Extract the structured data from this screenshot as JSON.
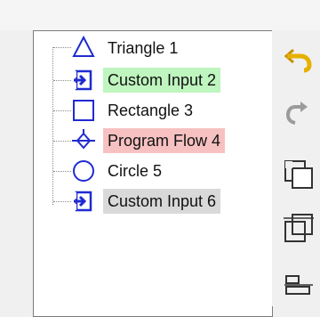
{
  "tree": {
    "items": [
      {
        "label": "Triangle 1",
        "icon": "triangle-icon",
        "highlight": null
      },
      {
        "label": "Custom Input 2",
        "icon": "custom-input-icon",
        "highlight": "#bff5bf"
      },
      {
        "label": "Rectangle 3",
        "icon": "rectangle-icon",
        "highlight": null
      },
      {
        "label": "Program Flow 4",
        "icon": "program-flow-icon",
        "highlight": "#f7c1c1"
      },
      {
        "label": "Circle 5",
        "icon": "circle-icon",
        "highlight": null
      },
      {
        "label": "Custom Input 6",
        "icon": "custom-input-icon",
        "highlight": "#d9d9d9"
      }
    ],
    "icon_color": "#1f2bd1"
  },
  "toolbar": {
    "tools": [
      "undo-icon",
      "redo-icon",
      "bring-forward-icon",
      "send-backward-icon",
      "align-icon"
    ],
    "accent": "#e6b000"
  }
}
